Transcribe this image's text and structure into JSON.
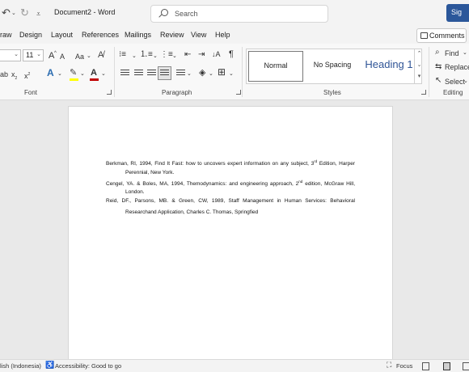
{
  "app": {
    "document_title": "Document2",
    "app_name": "Word",
    "title_separator": "-"
  },
  "search": {
    "placeholder": "Search"
  },
  "account": {
    "signin_label": "Sig"
  },
  "menu": {
    "items": [
      "raw",
      "Design",
      "Layout",
      "References",
      "Mailings",
      "Review",
      "View",
      "Help"
    ],
    "comments_label": "Comments"
  },
  "ribbon": {
    "font": {
      "size_value": "11",
      "change_case_label": "Aa",
      "grow_label": "A",
      "shrink_label": "A",
      "group_label": "Font",
      "subscript": "x",
      "superscript": "x",
      "text_effects": "A",
      "font_color": "A"
    },
    "paragraph": {
      "group_label": "Paragraph",
      "pilcrow": "¶"
    },
    "styles": {
      "group_label": "Styles",
      "items": [
        "Normal",
        "No Spacing",
        "Heading 1"
      ],
      "selected": "Normal"
    },
    "editing": {
      "group_label": "Editing",
      "find_label": "Find",
      "replace_label": "Replace",
      "select_label": "Select"
    }
  },
  "document": {
    "references": [
      {
        "before_sup": "Berkman, RI, 1994, Find It Fast: how to uncovers expert information on any subject, 3",
        "sup": "rd",
        "after_sup": " Edition, Harper Perennial, New York."
      },
      {
        "before_sup": "Cengel, YA. & Boles, MA, 1994, Themodynamics: and engineering approach, 2",
        "sup": "nd",
        "after_sup": " edition, McGraw Hill, London."
      },
      {
        "before_sup": "Reid, DF., Parsons, MB. & Green, CW, 1989, Staff Management in Human Services: Behavioral Researchand Application, Charles C. Thomas, Springfied",
        "sup": "",
        "after_sup": ""
      }
    ]
  },
  "status": {
    "language": "lish (Indonesia)",
    "accessibility": "Accessibility: Good to go",
    "focus_label": "Focus"
  },
  "colors": {
    "highlight": "#ffff00",
    "font_color": "#c00000",
    "heading": "#2f5496",
    "accent": "#2b579a"
  }
}
